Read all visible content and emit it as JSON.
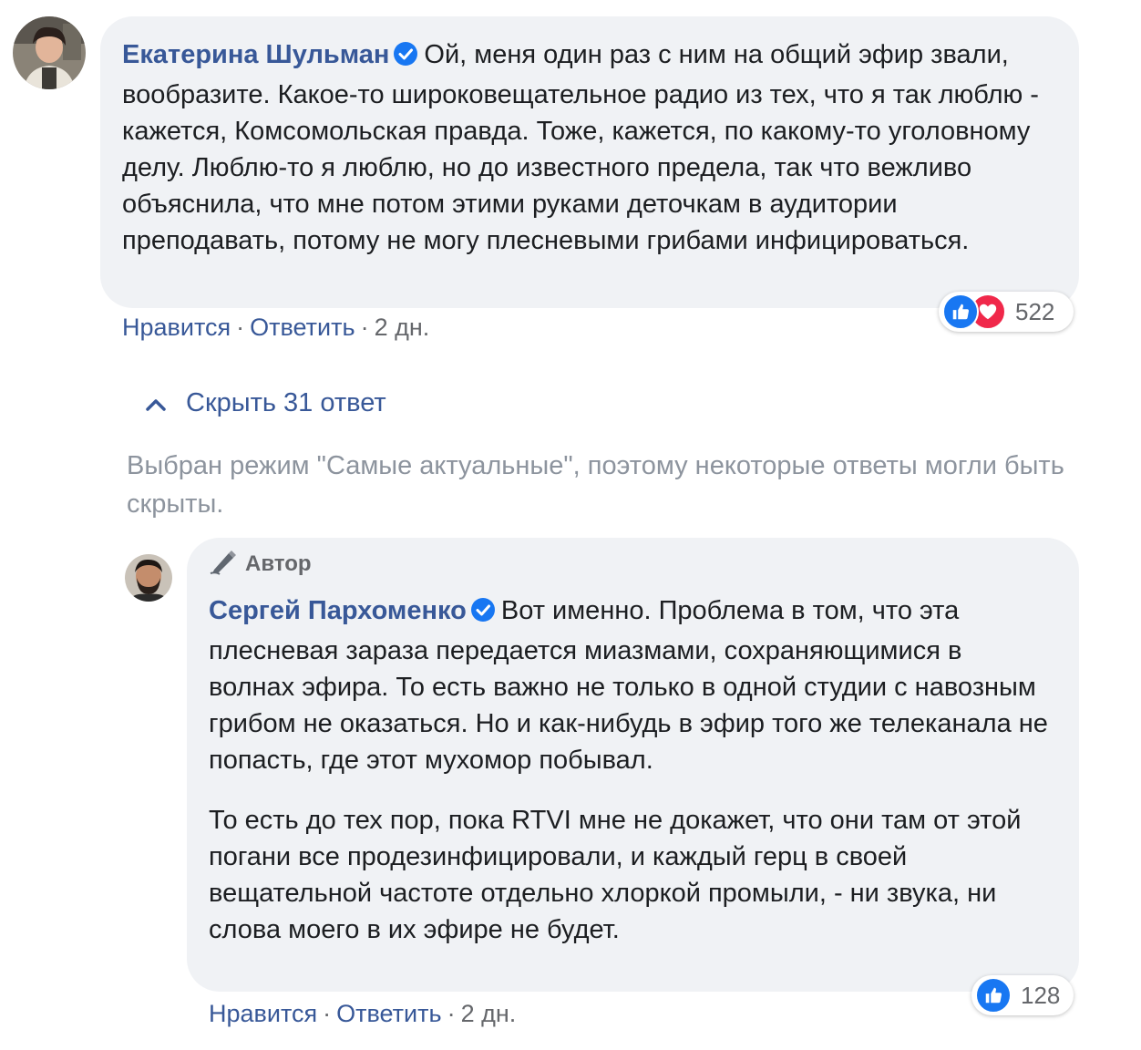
{
  "comment1": {
    "author": "Екатерина Шульман",
    "text": "Ой, меня один раз с ним на общий эфир звали, вообразите. Какое-то широковещательное радио из тех, что я так люблю - кажется, Комсомольская правда. Тоже, кажется, по какому-то уголовному делу. Люблю-то я люблю, но до известного предела, так что вежливо объяснила, что мне потом этими руками деточкам в аудитории преподавать, потому не могу плесневыми грибами инфицироваться.",
    "like_label": "Нравится",
    "reply_label": "Ответить",
    "time": "2 дн.",
    "reaction_count": "522",
    "reaction_icons": [
      "like-icon",
      "love-icon"
    ]
  },
  "replies": {
    "hide_label": "Скрыть 31 ответ",
    "notice": "Выбран режим \"Самые актуальные\", поэтому некоторые ответы могли быть скрыты."
  },
  "comment2": {
    "role": "Автор",
    "author": "Сергей Пархоменко",
    "text1": "Вот именно. Проблема в том, что эта плесневая зараза передается миазмами, сохраняющимися в волнах эфира. То есть важно не только в одной студии с навозным грибом не оказаться. Но и как-нибудь в эфир того же телеканала не попасть, где этот мухомор побывал.",
    "text2": "То есть до тех пор, пока RTVI мне не докажет, что они там от этой погани все продезинфицировали, и каждый герц в своей вещательной частоте отдельно хлоркой промыли, - ни звука, ни слова моего в их эфире не будет.",
    "like_label": "Нравится",
    "reply_label": "Ответить",
    "time": "2 дн.",
    "reaction_count": "128",
    "reaction_icons": [
      "like-icon"
    ]
  },
  "colors": {
    "link": "#385898",
    "bubble": "#f0f2f5",
    "like_blue": "#1877f2",
    "love_red": "#f0284a",
    "notice_gray": "#8d949e"
  }
}
